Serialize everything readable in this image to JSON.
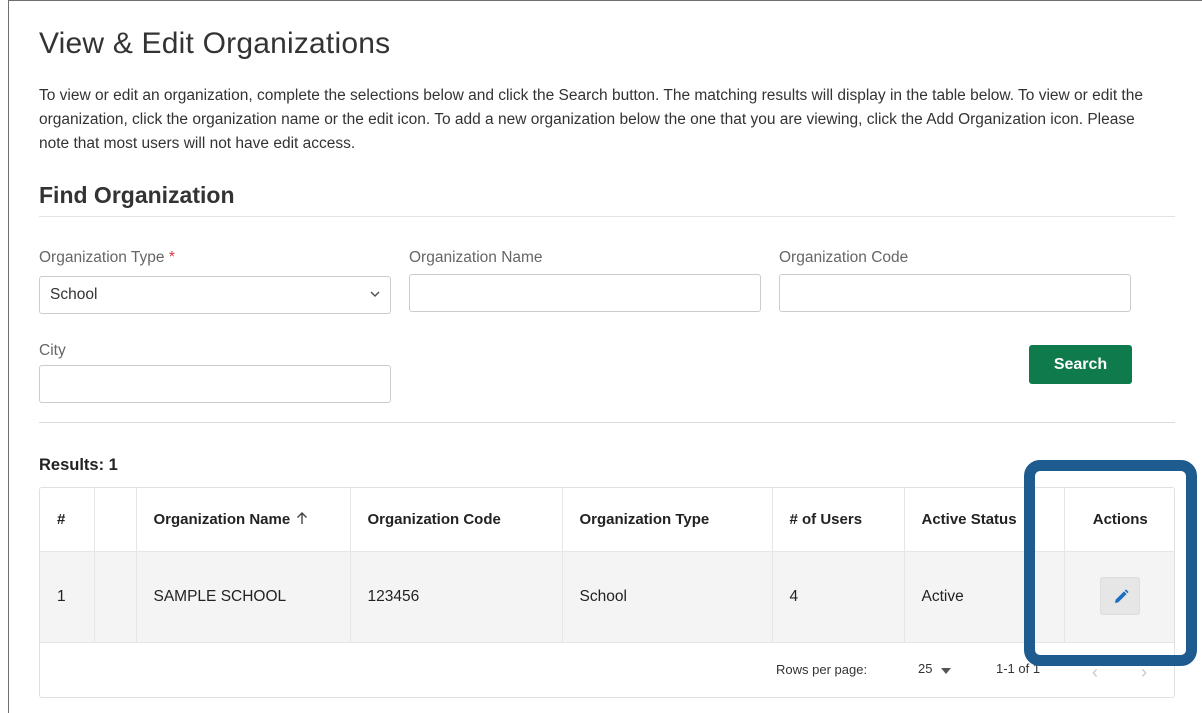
{
  "page": {
    "title": "View & Edit Organizations",
    "intro": "To view or edit an organization, complete the selections below and click the Search button. The matching results will display in the table below. To view or edit the organization, click the organization name or the edit icon. To add a new organization below the one that you are viewing, click the Add Organization icon. Please note that most users will not have edit access."
  },
  "find": {
    "title": "Find Organization",
    "org_type_label": "Organization Type",
    "required_mark": "*",
    "org_type_value": "School",
    "org_name_label": "Organization Name",
    "org_name_value": "",
    "org_code_label": "Organization Code",
    "org_code_value": "",
    "city_label": "City",
    "city_value": "",
    "search_label": "Search"
  },
  "results": {
    "label": "Results: 1",
    "columns": [
      "#",
      "",
      "Organization Name",
      "Organization Code",
      "Organization Type",
      "# of Users",
      "Active Status",
      "Actions"
    ],
    "rows": [
      {
        "num": "1",
        "extra": "",
        "name": "SAMPLE SCHOOL",
        "code": "123456",
        "type": "School",
        "users": "4",
        "status": "Active"
      }
    ],
    "sort_icon": "arrow-up-icon",
    "action_icon": "pencil-icon"
  },
  "pagination": {
    "rows_per_page_label": "Rows per page:",
    "rows_per_page_value": "25",
    "range": "1-1 of 1",
    "prev_icon": "chevron-left-icon",
    "next_icon": "chevron-right-icon"
  },
  "colors": {
    "primary_button": "#0f7a4c",
    "highlight": "#1e5b8e",
    "edit_icon": "#1a6fc2",
    "required": "#d9363e"
  }
}
